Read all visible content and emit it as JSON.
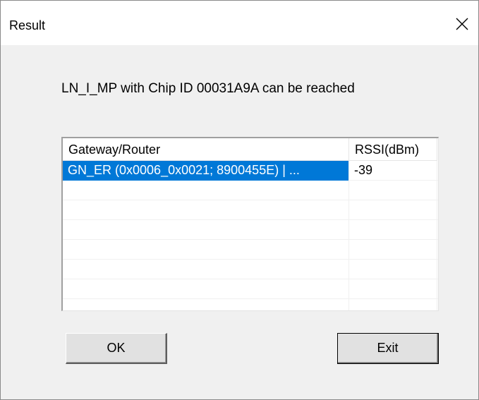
{
  "window": {
    "title": "Result",
    "close_glyph": "✕"
  },
  "message": "LN_I_MP with Chip ID 00031A9A can be reached",
  "table": {
    "columns": [
      "Gateway/Router",
      "RSSI(dBm)"
    ],
    "rows": [
      {
        "gateway": "GN_ER (0x0006_0x0021; 8900455E) | ...",
        "rssi": "-39",
        "selected": true
      }
    ]
  },
  "buttons": {
    "ok": "OK",
    "exit": "Exit"
  }
}
